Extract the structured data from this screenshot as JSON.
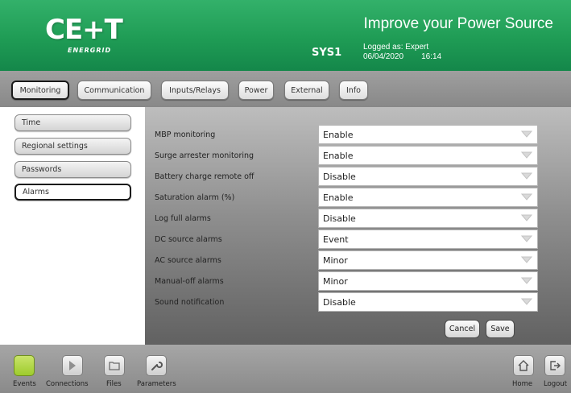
{
  "header": {
    "logo_text": "CE+T",
    "logo_sub": "ENERGRID",
    "tagline": "Improve your Power Source",
    "system_name": "SYS1",
    "logged_as": "Logged as: Expert",
    "date": "06/04/2020",
    "time": "16:14"
  },
  "tabs": [
    {
      "label": "Monitoring",
      "active": true
    },
    {
      "label": "Communication",
      "active": false
    },
    {
      "label": "Inputs/Relays",
      "active": false
    },
    {
      "label": "Power",
      "active": false
    },
    {
      "label": "External",
      "active": false
    },
    {
      "label": "Info",
      "active": false
    }
  ],
  "menu": [
    {
      "label": "Time",
      "active": false
    },
    {
      "label": "Regional settings",
      "active": false
    },
    {
      "label": "Passwords",
      "active": false
    },
    {
      "label": "Alarms",
      "active": true
    }
  ],
  "settings": [
    {
      "label": "MBP monitoring",
      "value": "Enable"
    },
    {
      "label": "Surge arrester monitoring",
      "value": "Enable"
    },
    {
      "label": "Battery charge remote off",
      "value": "Disable"
    },
    {
      "label": "Saturation alarm (%)",
      "value": "Enable"
    },
    {
      "label": "Log full alarms",
      "value": "Disable"
    },
    {
      "label": "DC source alarms",
      "value": "Event"
    },
    {
      "label": "AC source alarms",
      "value": "Minor"
    },
    {
      "label": "Manual-off alarms",
      "value": "Minor"
    },
    {
      "label": "Sound notification",
      "value": "Disable"
    }
  ],
  "actions": {
    "cancel_label": "Cancel",
    "save_label": "Save"
  },
  "bottom": {
    "events": "Events",
    "connections": "Connections",
    "files": "Files",
    "parameters": "Parameters",
    "home": "Home",
    "logout": "Logout"
  },
  "colors": {
    "header_green": "#1f9c55",
    "events_green": "#9ecc2d"
  }
}
